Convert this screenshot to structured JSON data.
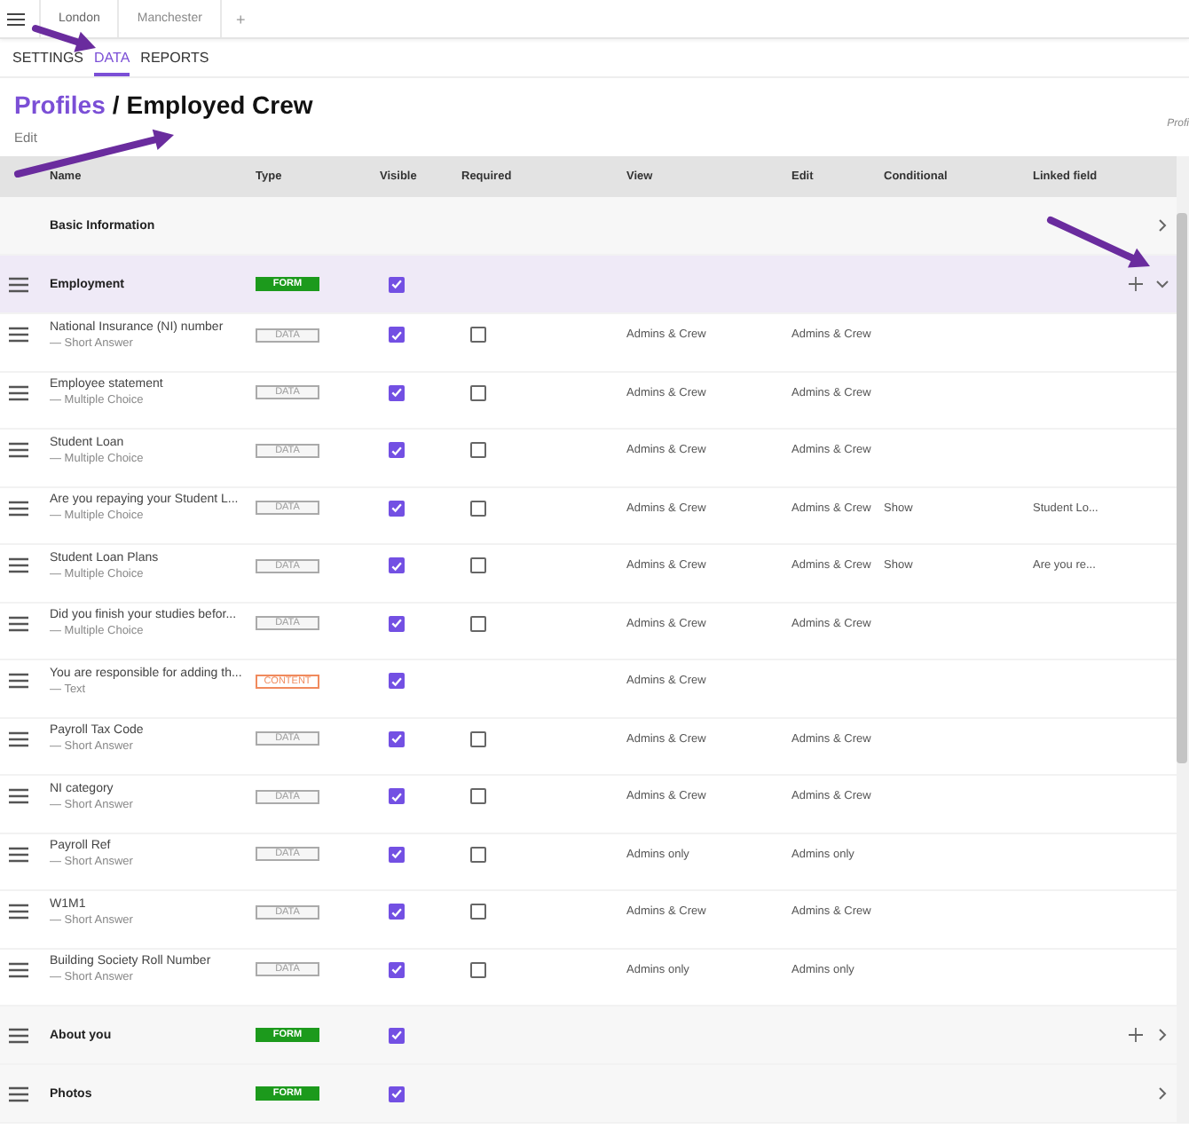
{
  "top_tabs": [
    {
      "label": "London",
      "selected": true
    },
    {
      "label": "Manchester",
      "selected": false
    }
  ],
  "add_tab": "+",
  "nav_tabs": [
    {
      "label": "SETTINGS",
      "selected": false
    },
    {
      "label": "DATA",
      "selected": true
    },
    {
      "label": "REPORTS",
      "selected": false
    }
  ],
  "breadcrumb": {
    "parent": "Profiles",
    "separator": "/",
    "current": "Employed Crew"
  },
  "edit_link": "Edit",
  "side_note": "Profi",
  "table": {
    "columns": [
      "Name",
      "Type",
      "Visible",
      "Required",
      "View",
      "Edit",
      "Conditional",
      "Linked field"
    ],
    "rows": [
      {
        "kind": "group",
        "name": "Basic Information",
        "draggable": false,
        "selected": false,
        "can_add": false,
        "expanded": false
      },
      {
        "kind": "group",
        "name": "Employment",
        "draggable": true,
        "badge": "FORM",
        "visible": true,
        "selected": true,
        "can_add": true,
        "expanded": true
      },
      {
        "kind": "field",
        "name": "National Insurance (NI) number",
        "subtype": "— Short Answer",
        "type": {
          "label": "DATA",
          "kind": "data"
        },
        "visible": true,
        "required": false,
        "view": "Admins & Crew",
        "edit": "Admins & Crew"
      },
      {
        "kind": "field",
        "name": "Employee statement",
        "subtype": "— Multiple Choice",
        "type": {
          "label": "DATA",
          "kind": "data"
        },
        "visible": true,
        "required": false,
        "view": "Admins & Crew",
        "edit": "Admins & Crew"
      },
      {
        "kind": "field",
        "name": "Student Loan",
        "subtype": "— Multiple Choice",
        "type": {
          "label": "DATA",
          "kind": "data"
        },
        "visible": true,
        "required": false,
        "view": "Admins & Crew",
        "edit": "Admins & Crew"
      },
      {
        "kind": "field",
        "name": "Are you repaying your Student L...",
        "subtype": "— Multiple Choice",
        "type": {
          "label": "DATA",
          "kind": "data"
        },
        "visible": true,
        "required": false,
        "view": "Admins & Crew",
        "edit": "Admins & Crew",
        "conditional": "Show",
        "linked": "Student Lo..."
      },
      {
        "kind": "field",
        "name": "Student Loan Plans",
        "subtype": "— Multiple Choice",
        "type": {
          "label": "DATA",
          "kind": "data"
        },
        "visible": true,
        "required": false,
        "view": "Admins & Crew",
        "edit": "Admins & Crew",
        "conditional": "Show",
        "linked": "Are you re..."
      },
      {
        "kind": "field",
        "name": "Did you finish your studies befor...",
        "subtype": "— Multiple Choice",
        "type": {
          "label": "DATA",
          "kind": "data"
        },
        "visible": true,
        "required": false,
        "view": "Admins & Crew",
        "edit": "Admins & Crew"
      },
      {
        "kind": "field",
        "name": "You are responsible for adding th...",
        "subtype": "— Text",
        "type": {
          "label": "CONTENT",
          "kind": "content"
        },
        "visible": true,
        "view": "Admins & Crew"
      },
      {
        "kind": "field",
        "name": "Payroll Tax Code",
        "subtype": "— Short Answer",
        "type": {
          "label": "DATA",
          "kind": "data"
        },
        "visible": true,
        "required": false,
        "view": "Admins & Crew",
        "edit": "Admins & Crew"
      },
      {
        "kind": "field",
        "name": "NI category",
        "subtype": "— Short Answer",
        "type": {
          "label": "DATA",
          "kind": "data"
        },
        "visible": true,
        "required": false,
        "view": "Admins & Crew",
        "edit": "Admins & Crew"
      },
      {
        "kind": "field",
        "name": "Payroll Ref",
        "subtype": "— Short Answer",
        "type": {
          "label": "DATA",
          "kind": "data"
        },
        "visible": true,
        "required": false,
        "view": "Admins only",
        "edit": "Admins only"
      },
      {
        "kind": "field",
        "name": "W1M1",
        "subtype": "— Short Answer",
        "type": {
          "label": "DATA",
          "kind": "data"
        },
        "visible": true,
        "required": false,
        "view": "Admins & Crew",
        "edit": "Admins & Crew"
      },
      {
        "kind": "field",
        "name": "Building Society Roll Number",
        "subtype": "— Short Answer",
        "type": {
          "label": "DATA",
          "kind": "data"
        },
        "visible": true,
        "required": false,
        "view": "Admins only",
        "edit": "Admins only"
      },
      {
        "kind": "group",
        "name": "About you",
        "draggable": true,
        "badge": "FORM",
        "visible": true,
        "selected": false,
        "can_add": true,
        "expanded": false
      },
      {
        "kind": "group",
        "name": "Photos",
        "draggable": true,
        "badge": "FORM",
        "visible": true,
        "selected": false,
        "can_add": false,
        "expanded": false
      }
    ]
  }
}
